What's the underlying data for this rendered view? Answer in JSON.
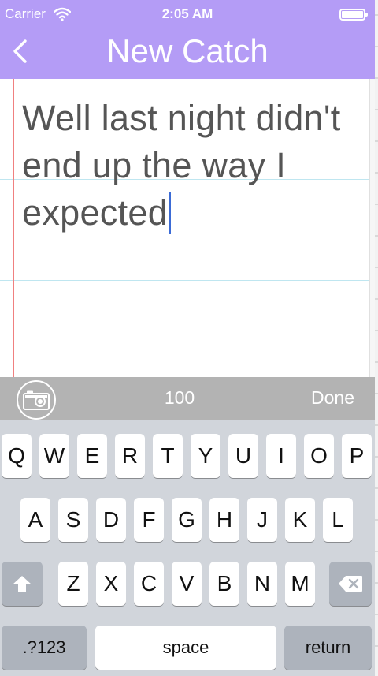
{
  "status_bar": {
    "carrier": "Carrier",
    "time": "2:05 AM",
    "wifi_icon": "wifi-icon",
    "battery_icon": "battery-icon"
  },
  "nav": {
    "back_icon": "chevron-left-icon",
    "title": "New Catch"
  },
  "note": {
    "lines": [
      "Well last night didn't",
      "end up the way I",
      "expected"
    ],
    "ruled_line_color": "#bfe6f0",
    "margin_line_color": "#f08080"
  },
  "toolbar": {
    "camera_icon": "camera-icon",
    "count": "100",
    "done_label": "Done"
  },
  "keyboard": {
    "row1": [
      "Q",
      "W",
      "E",
      "R",
      "T",
      "Y",
      "U",
      "I",
      "O",
      "P"
    ],
    "row2": [
      "A",
      "S",
      "D",
      "F",
      "G",
      "H",
      "J",
      "K",
      "L"
    ],
    "row3": [
      "Z",
      "X",
      "C",
      "V",
      "B",
      "N",
      "M"
    ],
    "shift_icon": "shift-icon",
    "delete_icon": "delete-icon",
    "numbers_label": ".?123",
    "space_label": "space",
    "return_label": "return"
  },
  "colors": {
    "header": "#b49cf6",
    "toolbar": "#b3b3b3",
    "keyboard": "#d1d5db",
    "caret": "#3b6bd6"
  }
}
